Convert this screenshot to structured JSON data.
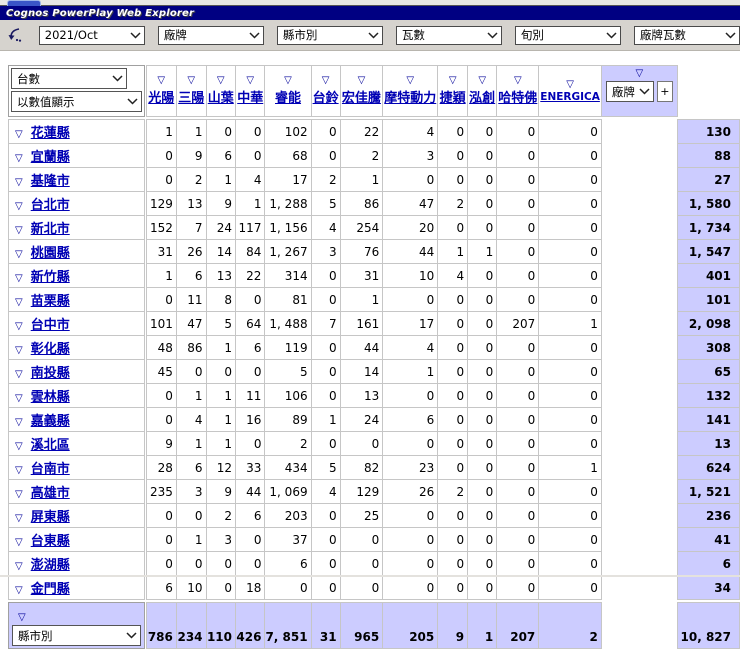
{
  "title_bar": {
    "title": "Cognos PowerPlay Web Explorer"
  },
  "toolbar": {
    "dropdowns": [
      {
        "value": "2021/Oct"
      },
      {
        "value": "廠牌"
      },
      {
        "value": "縣市別"
      },
      {
        "value": "瓦數"
      },
      {
        "value": "旬別"
      },
      {
        "value": "廠牌瓦數"
      }
    ]
  },
  "crosstab": {
    "filter_glyph": "▽",
    "measure_dropdown": {
      "value": "台數"
    },
    "display_dropdown": {
      "value": "以數值顯示"
    },
    "column_dimension_dropdown": {
      "value": "廠牌"
    },
    "row_dimension_dropdown": {
      "value": "縣市別"
    },
    "add_column_button": "+",
    "columns": [
      "光陽",
      "三陽",
      "山葉",
      "中華",
      "睿能",
      "台鈴",
      "宏佳騰",
      "摩特動力",
      "捷穎",
      "泓創",
      "哈特佛",
      "ENERGICA"
    ],
    "rows": [
      {
        "label": "花蓮縣",
        "values": [
          "1",
          "1",
          "0",
          "0",
          "102",
          "0",
          "22",
          "4",
          "0",
          "0",
          "0",
          "0"
        ],
        "total": "130"
      },
      {
        "label": "宜蘭縣",
        "values": [
          "0",
          "9",
          "6",
          "0",
          "68",
          "0",
          "2",
          "3",
          "0",
          "0",
          "0",
          "0"
        ],
        "total": "88"
      },
      {
        "label": "基隆市",
        "values": [
          "0",
          "2",
          "1",
          "4",
          "17",
          "2",
          "1",
          "0",
          "0",
          "0",
          "0",
          "0"
        ],
        "total": "27"
      },
      {
        "label": "台北市",
        "values": [
          "129",
          "13",
          "9",
          "1",
          "1, 288",
          "5",
          "86",
          "47",
          "2",
          "0",
          "0",
          "0"
        ],
        "total": "1, 580"
      },
      {
        "label": "新北市",
        "values": [
          "152",
          "7",
          "24",
          "117",
          "1, 156",
          "4",
          "254",
          "20",
          "0",
          "0",
          "0",
          "0"
        ],
        "total": "1, 734"
      },
      {
        "label": "桃園縣",
        "values": [
          "31",
          "26",
          "14",
          "84",
          "1, 267",
          "3",
          "76",
          "44",
          "1",
          "1",
          "0",
          "0"
        ],
        "total": "1, 547"
      },
      {
        "label": "新竹縣",
        "values": [
          "1",
          "6",
          "13",
          "22",
          "314",
          "0",
          "31",
          "10",
          "4",
          "0",
          "0",
          "0"
        ],
        "total": "401"
      },
      {
        "label": "苗栗縣",
        "values": [
          "0",
          "11",
          "8",
          "0",
          "81",
          "0",
          "1",
          "0",
          "0",
          "0",
          "0",
          "0"
        ],
        "total": "101"
      },
      {
        "label": "台中市",
        "values": [
          "101",
          "47",
          "5",
          "64",
          "1, 488",
          "7",
          "161",
          "17",
          "0",
          "0",
          "207",
          "1"
        ],
        "total": "2, 098"
      },
      {
        "label": "彰化縣",
        "values": [
          "48",
          "86",
          "1",
          "6",
          "119",
          "0",
          "44",
          "4",
          "0",
          "0",
          "0",
          "0"
        ],
        "total": "308"
      },
      {
        "label": "南投縣",
        "values": [
          "45",
          "0",
          "0",
          "0",
          "5",
          "0",
          "14",
          "1",
          "0",
          "0",
          "0",
          "0"
        ],
        "total": "65"
      },
      {
        "label": "雲林縣",
        "values": [
          "0",
          "1",
          "1",
          "11",
          "106",
          "0",
          "13",
          "0",
          "0",
          "0",
          "0",
          "0"
        ],
        "total": "132"
      },
      {
        "label": "嘉義縣",
        "values": [
          "0",
          "4",
          "1",
          "16",
          "89",
          "1",
          "24",
          "6",
          "0",
          "0",
          "0",
          "0"
        ],
        "total": "141"
      },
      {
        "label": "溪北區",
        "values": [
          "9",
          "1",
          "1",
          "0",
          "2",
          "0",
          "0",
          "0",
          "0",
          "0",
          "0",
          "0"
        ],
        "total": "13"
      },
      {
        "label": "台南市",
        "values": [
          "28",
          "6",
          "12",
          "33",
          "434",
          "5",
          "82",
          "23",
          "0",
          "0",
          "0",
          "1"
        ],
        "total": "624"
      },
      {
        "label": "高雄市",
        "values": [
          "235",
          "3",
          "9",
          "44",
          "1, 069",
          "4",
          "129",
          "26",
          "2",
          "0",
          "0",
          "0"
        ],
        "total": "1, 521"
      },
      {
        "label": "屏東縣",
        "values": [
          "0",
          "0",
          "2",
          "6",
          "203",
          "0",
          "25",
          "0",
          "0",
          "0",
          "0",
          "0"
        ],
        "total": "236"
      },
      {
        "label": "台東縣",
        "values": [
          "0",
          "1",
          "3",
          "0",
          "37",
          "0",
          "0",
          "0",
          "0",
          "0",
          "0",
          "0"
        ],
        "total": "41"
      },
      {
        "label": "澎湖縣",
        "values": [
          "0",
          "0",
          "0",
          "0",
          "6",
          "0",
          "0",
          "0",
          "0",
          "0",
          "0",
          "0"
        ],
        "total": "6"
      },
      {
        "label": "金門縣",
        "values": [
          "6",
          "10",
          "0",
          "18",
          "0",
          "0",
          "0",
          "0",
          "0",
          "0",
          "0",
          "0"
        ],
        "total": "34"
      }
    ],
    "totals": {
      "values": [
        "786",
        "234",
        "110",
        "426",
        "7, 851",
        "31",
        "965",
        "205",
        "9",
        "1",
        "207",
        "2"
      ],
      "grand_total": "10, 827"
    }
  }
}
